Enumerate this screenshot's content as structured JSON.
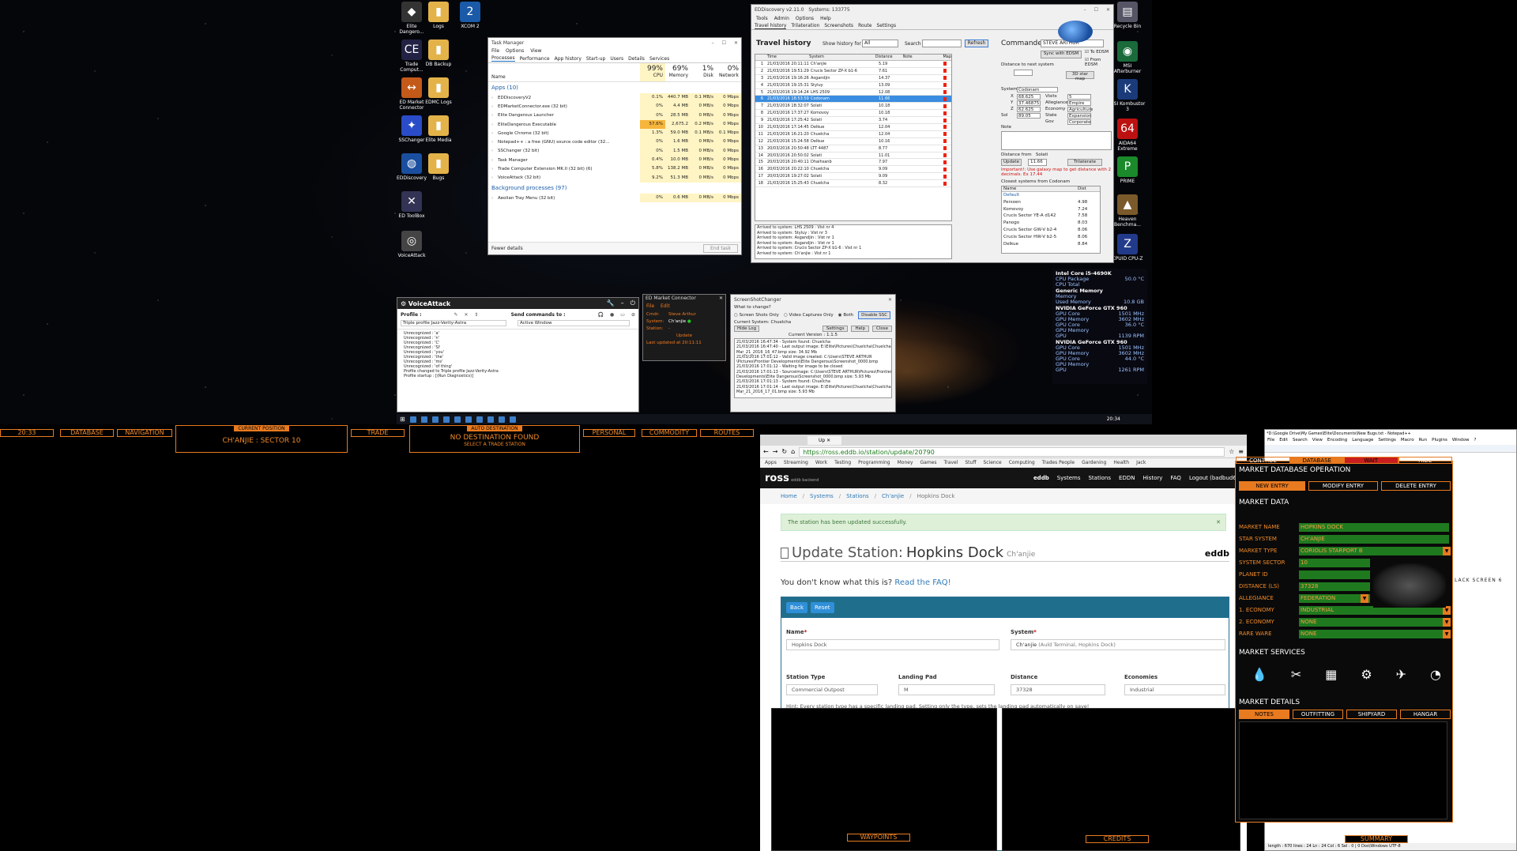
{
  "desktop": {
    "icons": [
      {
        "label": "Elite Dangero...",
        "glyph": "◆",
        "color": "#333"
      },
      {
        "label": "Logs",
        "glyph": "▮",
        "color": "#e3b34a"
      },
      {
        "label": "XCOM 2",
        "glyph": "2",
        "color": "#1a5aa8"
      },
      {
        "label": "Trade Comput...",
        "glyph": "CE",
        "color": "#224"
      },
      {
        "label": "DB Backup",
        "glyph": "▮",
        "color": "#e3b34a"
      },
      {
        "label": "ED Market Connector",
        "glyph": "↔",
        "color": "#c35a1a"
      },
      {
        "label": "EDMC Logs",
        "glyph": "▮",
        "color": "#e3b34a"
      },
      {
        "label": "SSChanger",
        "glyph": "✦",
        "color": "#2a4cc8"
      },
      {
        "label": "Elite Media",
        "glyph": "▮",
        "color": "#e3b34a"
      },
      {
        "label": "EDDiscovery",
        "glyph": "◍",
        "color": "#1a4fa0"
      },
      {
        "label": "Bugs",
        "glyph": "▮",
        "color": "#e3b34a"
      },
      {
        "label": "ED ToolBox",
        "glyph": "✕",
        "color": "#335"
      },
      {
        "label": "VoiceAttack",
        "glyph": "◎",
        "color": "#444"
      },
      {
        "label": "Recycle Bin",
        "glyph": "▤",
        "color": "#556"
      },
      {
        "label": "MSI Afterburner",
        "glyph": "◉",
        "color": "#1a6a3a"
      },
      {
        "label": "MSI Kombustor 3",
        "glyph": "K",
        "color": "#1a3a7a"
      },
      {
        "label": "AIDA64 Extreme",
        "glyph": "64",
        "color": "#b11"
      },
      {
        "label": "PRIME",
        "glyph": "P",
        "color": "#1a8a2a"
      },
      {
        "label": "Heaven Benchma...",
        "glyph": "▲",
        "color": "#7a5a2a"
      },
      {
        "label": "CPUID CPU-Z",
        "glyph": "Z",
        "color": "#223a8a"
      }
    ]
  },
  "task_manager": {
    "title": "Task Manager",
    "menu": [
      "File",
      "Options",
      "View"
    ],
    "tabs": [
      "Processes",
      "Performance",
      "App history",
      "Start-up",
      "Users",
      "Details",
      "Services"
    ],
    "columns": {
      "name": "Name",
      "cpu_pct": "99%",
      "cpu": "CPU",
      "mem_pct": "69%",
      "mem": "Memory",
      "disk_pct": "1%",
      "disk": "Disk",
      "net_pct": "0%",
      "net": "Network"
    },
    "apps_header": "Apps (10)",
    "apps": [
      {
        "name": "EDDiscoveryV2",
        "cpu": "0.1%",
        "mem": "440.7 MB",
        "disk": "0.1 MB/s",
        "net": "0 Mbps"
      },
      {
        "name": "EDMarketConnector.exe (32 bit)",
        "cpu": "0%",
        "mem": "4.4 MB",
        "disk": "0 MB/s",
        "net": "0 Mbps"
      },
      {
        "name": "Elite Dangerous Launcher",
        "cpu": "0%",
        "mem": "28.5 MB",
        "disk": "0 MB/s",
        "net": "0 Mbps"
      },
      {
        "name": "EliteDangerous Executable",
        "cpu": "57.6%",
        "mem": "2,675.2 MB",
        "disk": "0.2 MB/s",
        "net": "0 Mbps"
      },
      {
        "name": "Google Chrome (32 bit)",
        "cpu": "1.3%",
        "mem": "59.0 MB",
        "disk": "0.1 MB/s",
        "net": "0.1 Mbps"
      },
      {
        "name": "Notepad++ : a free (GNU) source code editor (32...",
        "cpu": "0%",
        "mem": "1.6 MB",
        "disk": "0 MB/s",
        "net": "0 Mbps"
      },
      {
        "name": "SSChanger (32 bit)",
        "cpu": "0%",
        "mem": "1.5 MB",
        "disk": "0 MB/s",
        "net": "0 Mbps"
      },
      {
        "name": "Task Manager",
        "cpu": "0.4%",
        "mem": "10.0 MB",
        "disk": "0 MB/s",
        "net": "0 Mbps"
      },
      {
        "name": "Trade Computer Extension MK.II (32 bit) (6)",
        "cpu": "5.8%",
        "mem": "138.2 MB",
        "disk": "0 MB/s",
        "net": "0 Mbps"
      },
      {
        "name": "VoiceAttack (32 bit)",
        "cpu": "9.2%",
        "mem": "51.3 MB",
        "disk": "0 MB/s",
        "net": "0 Mbps"
      }
    ],
    "bg_header": "Background processes (97)",
    "bg": [
      {
        "name": "Aeolian Tray Menu (32 bit)",
        "cpu": "0%",
        "mem": "0.6 MB",
        "disk": "0 MB/s",
        "net": "0 Mbps"
      }
    ],
    "fewer_details": "Fewer details",
    "end_task": "End task"
  },
  "eddiscovery": {
    "title": "EDDiscovery v2.11.0",
    "systems": "Systems: 133775",
    "menu": [
      "Tools",
      "Admin",
      "Options",
      "Help"
    ],
    "tabs": [
      "Travel history",
      "Trilateration",
      "Screenshots",
      "Route",
      "Settings"
    ],
    "heading": "Travel history",
    "show_label": "Show history for last",
    "show_value": "All",
    "search_label": "Search",
    "refresh": "Refresh",
    "commander_label": "Commander",
    "commander": "STEVE ARTHUR",
    "sync": "Sync with EDSM",
    "to_edsm": "To EDSM",
    "from_edsm": "From EDSM",
    "dist_next": "Distance to next system",
    "map_3d": "3D star map",
    "columns": [
      "Time",
      "System",
      "Distance",
      "Note",
      "Map"
    ],
    "rows": [
      {
        "n": "1",
        "time": "21/03/2016 20:11:11",
        "sys": "Ch'anjie",
        "dist": "5.19"
      },
      {
        "n": "2",
        "time": "21/03/2016 19:51:29",
        "sys": "Crucis Sector ZP-X b1-6",
        "dist": "7.61"
      },
      {
        "n": "3",
        "time": "21/03/2016 19:16:26",
        "sys": "Asgandjin",
        "dist": "14.37"
      },
      {
        "n": "4",
        "time": "21/03/2016 19:15:31",
        "sys": "Styluy",
        "dist": "13.09"
      },
      {
        "n": "5",
        "time": "21/03/2016 19:14:24",
        "sys": "LHS 2509",
        "dist": "12.08"
      },
      {
        "n": "6",
        "time": "21/03/2016 18:53:59",
        "sys": "Codonam",
        "dist": "11.66",
        "sel": true
      },
      {
        "n": "7",
        "time": "21/03/2016 18:32:07",
        "sys": "Solati",
        "dist": "10.18"
      },
      {
        "n": "8",
        "time": "21/03/2016 17:37:27",
        "sys": "Komovoy",
        "dist": "10.18"
      },
      {
        "n": "9",
        "time": "21/03/2016 17:25:42",
        "sys": "Solati",
        "dist": "3.74"
      },
      {
        "n": "10",
        "time": "21/03/2016 17:14:45",
        "sys": "Delkue",
        "dist": "12.04"
      },
      {
        "n": "11",
        "time": "21/03/2016 16:21:20",
        "sys": "Chuelcha",
        "dist": "12.04"
      },
      {
        "n": "12",
        "time": "21/03/2016 15:24:58",
        "sys": "Delkue",
        "dist": "10.16"
      },
      {
        "n": "13",
        "time": "20/03/2016 20:50:48",
        "sys": "LTT 4487",
        "dist": "8.77"
      },
      {
        "n": "14",
        "time": "20/03/2016 20:50:02",
        "sys": "Solati",
        "dist": "11.01"
      },
      {
        "n": "15",
        "time": "20/03/2016 20:40:11",
        "sys": "Dhaihsanb",
        "dist": "7.97"
      },
      {
        "n": "16",
        "time": "20/03/2016 20:22:10",
        "sys": "Chuelcha",
        "dist": "9.09"
      },
      {
        "n": "17",
        "time": "20/03/2016 19:27:02",
        "sys": "Solati",
        "dist": "9.09"
      },
      {
        "n": "18",
        "time": "21/03/2016 15:25:43",
        "sys": "Chuelcha",
        "dist": "8.32"
      }
    ],
    "log": [
      "Arrived to system: LHS 2509 : Vist nr 4",
      "Arrived to system: Styluy : Vist nr 3",
      "Arrived to system: Asgandjin : Vist nr 1",
      "Arrived to system: Asgandjin : Vist nr 1",
      "Arrived to system: Crucis Sector ZP-X b1-6 : Vist nr 1",
      "Arrived to system: Ch'anjie : Vist nr 1"
    ],
    "system_box": {
      "system": "Codonam",
      "x": "68.625",
      "y": "37.46875",
      "z": "62.625",
      "sol": "89.05",
      "visits": "5",
      "allegiance": "Empire",
      "economy": "Agriculture",
      "state": "Expansion",
      "gov": "Corporate"
    },
    "note_label": "Note",
    "dist_from": "Distance from",
    "dist_from_sys": "Solati",
    "update": "Update",
    "dist_val": "11.66",
    "trilat": "Trilaterate",
    "warning": "Important!: Use galaxy map to get distance with 2 decimals. Ex 17.44",
    "closest_label": "Closest systems from Codonam",
    "closest_cols": [
      "Name",
      "Dist"
    ],
    "closest": [
      {
        "name": "Default",
        "dist": ""
      },
      {
        "name": "Persoen",
        "dist": "4.98"
      },
      {
        "name": "Komovoy",
        "dist": "7.24"
      },
      {
        "name": "Crucis Sector YE-A d142",
        "dist": "7.58"
      },
      {
        "name": "Panogo",
        "dist": "8.03"
      },
      {
        "name": "Crucis Sector GW-V b2-4",
        "dist": "8.06"
      },
      {
        "name": "Crucis Sector HW-V b2-5",
        "dist": "8.06"
      },
      {
        "name": "Delkue",
        "dist": "8.84"
      }
    ]
  },
  "voiceattack": {
    "title": "VoiceAttack",
    "profile_label": "Profile :",
    "send_label": "Send commands to :",
    "profile": "Triple profile Jazz-Verity-Astra",
    "target": "Active Window",
    "log": [
      "Unrecognized : 'a'",
      "Unrecognized : 'n'",
      "Unrecognized : 'C'",
      "Unrecognized : 'SI'",
      "Unrecognized : 'you'",
      "Unrecognized : 'the'",
      "Unrecognized : 'ms'",
      "Unrecognized : 'of thing'",
      "Profile changed to Triple profile Jazz-Verity-Astra",
      "Profile startup : [(Run Diagnostics)]"
    ]
  },
  "emc": {
    "title": "ED Market Connector",
    "menu": [
      "File",
      "Edit"
    ],
    "cmdr_label": "Cmdr:",
    "cmdr": "Steve Arthur",
    "system_label": "System:",
    "system": "Ch'anjie",
    "station_label": "Station:",
    "station": "-",
    "update": "Update",
    "last": "Last updated at 20:11:11"
  },
  "sschanger": {
    "title": "ScreenShotChanger",
    "what": "What to change?",
    "opt1": "Screen Shots Only",
    "opt2": "Video Captures Only",
    "opt3": "Both",
    "disable": "Disable SSC",
    "current": "Current System: Chuelcha",
    "hide": "Hide Log",
    "settings": "Settings",
    "help": "Help",
    "close": "Close",
    "version": "Current Version : 1.1.5",
    "log": [
      "21/03/2016 16:47:34 - System found: Chuelcha",
      "21/03/2016 16:47:40 - Last output image: E:\\Elite\\Pictures\\Chuelcha\\Chuelcha",
      "Mar_21_2016_16_47.bmp size: 34.92 Mb",
      "21/03/2016 17:01:12 - Valid image created: C:\\Users\\STEVE ARTHUR",
      "\\Pictures\\Frontier Developments\\Elite Dangerous\\Screenshot_0000.bmp",
      "21/03/2016 17:01:12 - Waiting for image to be closed",
      "21/03/2016 17:01:13 - Sourceimage: C:\\Users\\STEVE ARTHUR\\Pictures\\Frontier",
      "Developments\\Elite Dangerous\\Screenshot_0000.bmp size: 5.93 Mb",
      "21/03/2016 17:01:13 - System found: Chuelcha",
      "21/03/2016 17:01:14 - Last output image: E:\\Elite\\Pictures\\Chuelcha\\Chuelcha",
      "Mar_21_2016_17_01.bmp size: 5.93 Mb"
    ]
  },
  "hwmon": {
    "cpu": "Intel Core i5-4690K",
    "rows1": [
      [
        "CPU Package",
        "50.0 °C"
      ],
      [
        "CPU Total",
        ""
      ]
    ],
    "mem": "Generic Memory",
    "rows2": [
      [
        "Memory",
        ""
      ],
      [
        "Used Memory",
        "10.8 GB"
      ]
    ],
    "gpu1": "NVIDIA GeForce GTX 960",
    "rows3": [
      [
        "GPU Core",
        "1501 MHz"
      ],
      [
        "GPU Memory",
        "3602 MHz"
      ],
      [
        "GPU Core",
        "36.0 °C"
      ],
      [
        "GPU Memory",
        ""
      ],
      [
        "GPU",
        "1139 RPM"
      ]
    ],
    "gpu2": "NVIDIA GeForce GTX 960",
    "rows4": [
      [
        "GPU Core",
        "1501 MHz"
      ],
      [
        "GPU Memory",
        "3602 MHz"
      ],
      [
        "GPU Core",
        "44.0 °C"
      ],
      [
        "GPU Memory",
        ""
      ],
      [
        "GPU",
        "1261 RPM"
      ]
    ]
  },
  "taskbar": {
    "time": "20:34"
  },
  "hud": {
    "time": "20:33",
    "database": "DATABASE",
    "navigation": "NAVIGATION",
    "current_pos_label": "CURRENT POSITION",
    "current_pos": "CH'ANJIE : SECTOR 10",
    "trade": "TRADE",
    "auto_dest_label": "AUTO DESTINATION",
    "no_dest": "NO DESTINATION FOUND",
    "select_trade": "SELECT A TRADE STATION",
    "personal": "PERSONAL",
    "commodity": "COMMODITY",
    "routes": "ROUTES",
    "waypoints": "WAYPOINTS",
    "credits": "CREDITS",
    "summary": "SUMMARY"
  },
  "browser": {
    "url": "https://ross.eddb.io/station/update/20790",
    "bookmarks": [
      "Apps",
      "Streaming",
      "Work",
      "Testing",
      "Programming",
      "Money",
      "Games",
      "Travel",
      "Stuff",
      "Science",
      "Computing",
      "Trades People",
      "Gardening",
      "Health",
      "Jack"
    ],
    "logo": "ross",
    "logo_sub": "eddb backend",
    "nav_brand": "eddb",
    "nav": [
      "Systems",
      "Stations",
      "EDDN",
      "History",
      "FAQ",
      "Logout (badbud65)"
    ],
    "crumbs": [
      "Home",
      "Systems",
      "Stations",
      "Ch'anjie",
      "Hopkins Dock"
    ],
    "alert": "The station has been updated successfully.",
    "page_title": "Update Station:",
    "station": "Hopkins Dock",
    "station_sys": "Ch'anjie",
    "faq_q": "You don't know what this is?",
    "faq_link": "Read the FAQ!",
    "back": "Back",
    "reset": "Reset",
    "name_label": "Name",
    "name_val": "Hopkins Dock",
    "system_label": "System",
    "system_val": "Ch'anjie",
    "system_hint": "(Auld Terminal, Hopkins Dock)",
    "type_label": "Station Type",
    "type_val": "Commercial Outpost",
    "pad_label": "Landing Pad",
    "pad_val": "M",
    "dist_label": "Distance",
    "dist_val": "37328",
    "econ_label": "Economies",
    "econ_val": "Industrial",
    "hint": "Hint: Every station type has a specific landing pad. Setting only the type, sets the landing pad automatically on save!"
  },
  "notepad": {
    "title": "*D:\\Google Drive\\My Games\\Elite\\Documents\\New Bugs.txt - Notepad++",
    "menu": [
      "File",
      "Edit",
      "Search",
      "View",
      "Encoding",
      "Language",
      "Settings",
      "Macro",
      "Run",
      "Plugins",
      "Window",
      "?"
    ],
    "text": "LACK SCREEN 6",
    "status": "length : 670   lines : 24   Ln : 24   Col : 6   Sel : 0 | 0        Dos\\Windows     UTF-8"
  },
  "mdb": {
    "tabs": [
      "CONTROL",
      "DATABASE",
      "WAIT",
      "HIDE"
    ],
    "title": "MARKET DATABASE OPERATION",
    "new_entry": "NEW ENTRY",
    "modify": "MODIFY ENTRY",
    "delete": "DELETE ENTRY",
    "data_title": "MARKET DATA",
    "fields": [
      [
        "MARKET NAME",
        "HOPKINS DOCK"
      ],
      [
        "STAR SYSTEM",
        "CH'ANJIE"
      ],
      [
        "MARKET TYPE",
        "CORIOLIS STARPORT B"
      ],
      [
        "SYSTEM SECTOR",
        "10"
      ],
      [
        "PLANET ID",
        ""
      ],
      [
        "DISTANCE (LS)",
        "37328"
      ],
      [
        "ALLEGIANCE",
        "FEDERATION"
      ],
      [
        "1. ECONOMY",
        "INDUSTRIAL"
      ],
      [
        "2. ECONOMY",
        "NONE"
      ],
      [
        "RARE WARE",
        "NONE"
      ]
    ],
    "services_title": "MARKET SERVICES",
    "details_title": "MARKET DETAILS",
    "detail_tabs": [
      "NOTES",
      "OUTFITTING",
      "SHIPYARD",
      "HANGAR"
    ],
    "colors": {
      "accent": "#e87a20",
      "green": "#1f7a1f"
    }
  }
}
